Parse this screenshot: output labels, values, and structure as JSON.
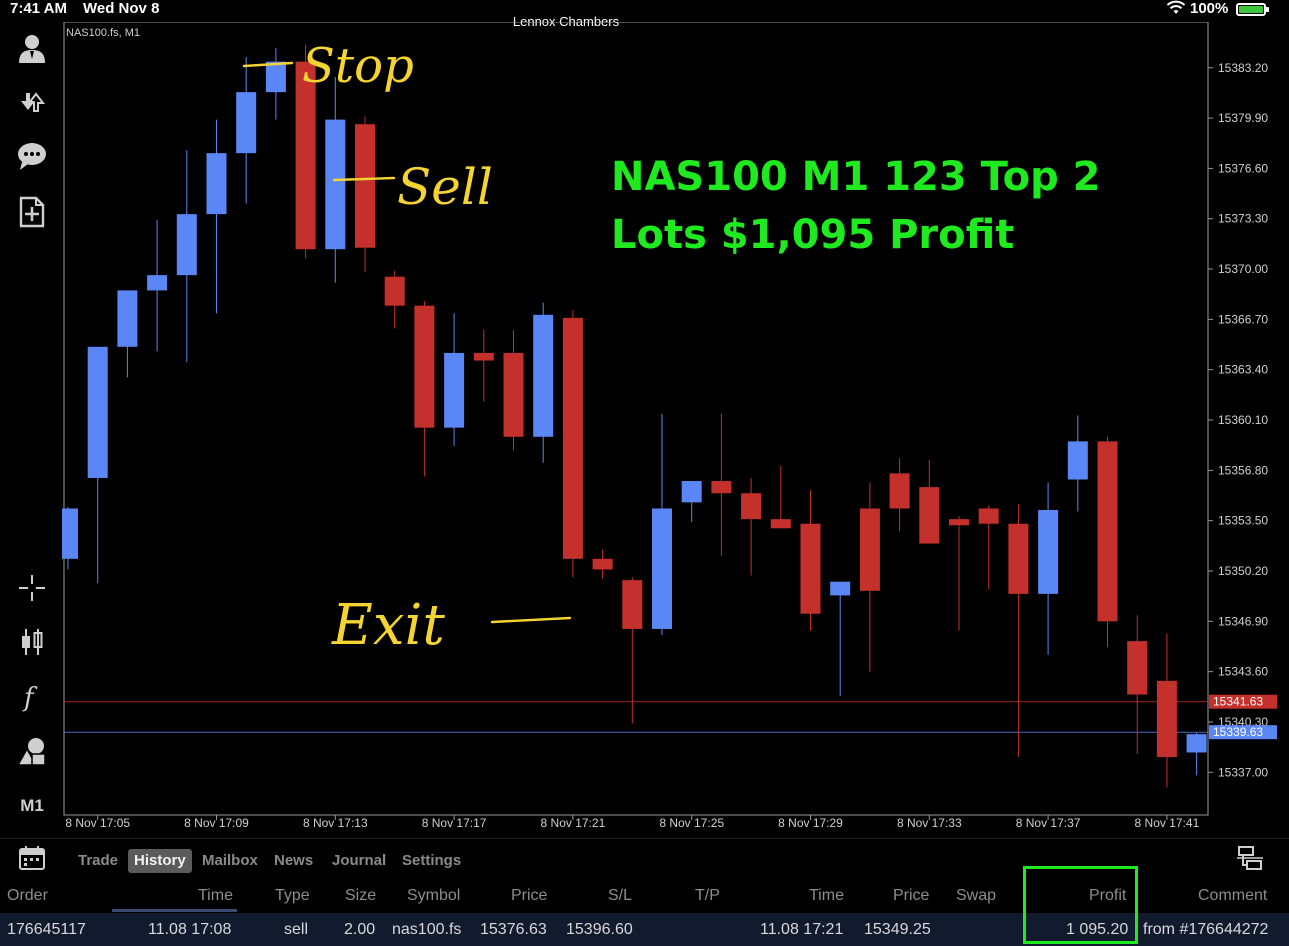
{
  "status_bar": {
    "time": "7:41 AM",
    "date": "Wed Nov 8",
    "account_name": "Lennox Chambers",
    "battery": "100%"
  },
  "toolbar": {
    "items": [
      "account-icon",
      "deposit-withdraw-icon",
      "chat-icon",
      "new-document-icon",
      "crosshair-icon",
      "candlestick-icon",
      "indicator-function-icon",
      "objects-icon"
    ],
    "timeframe": "M1"
  },
  "chart": {
    "symbol_label": "NAS100.fs, M1",
    "overlay_line1": "NAS100 M1 123 Top 2",
    "overlay_line2": "Lots $1,095 Profit",
    "annotations": [
      "Stop",
      "Sell",
      "Exit"
    ],
    "price_ticks": [
      "15383.20",
      "15379.90",
      "15376.60",
      "15373.30",
      "15370.00",
      "15366.70",
      "15363.40",
      "15360.10",
      "15356.80",
      "15353.50",
      "15350.20",
      "15346.90",
      "15343.60",
      "15340.30",
      "15337.00"
    ],
    "time_ticks": [
      "8 Nov 17:05",
      "8 Nov 17:09",
      "8 Nov 17:13",
      "8 Nov 17:17",
      "8 Nov 17:21",
      "8 Nov 17:25",
      "8 Nov 17:29",
      "8 Nov 17:33",
      "8 Nov 17:37",
      "8 Nov 17:41"
    ],
    "bid_label": "15341.63",
    "ask_label": "15339.63",
    "colors": {
      "bull": "#5b86f5",
      "bear": "#c4302b",
      "overlay": "#1fe91f",
      "annotation": "#f5d431"
    }
  },
  "chart_data": {
    "type": "candlestick",
    "ylim": [
      15334.2,
      15386.2
    ],
    "bid": 15341.63,
    "ask": 15339.63,
    "candles": [
      {
        "o": 15351.0,
        "h": 15354.4,
        "l": 15350.3,
        "c": 15354.3
      },
      {
        "o": 15356.3,
        "h": 15363.8,
        "l": 15349.4,
        "c": 15364.9
      },
      {
        "o": 15364.9,
        "h": 15367.3,
        "l": 15362.9,
        "c": 15368.6
      },
      {
        "o": 15368.6,
        "h": 15373.2,
        "l": 15364.6,
        "c": 15369.6
      },
      {
        "o": 15369.6,
        "h": 15377.8,
        "l": 15363.9,
        "c": 15373.6
      },
      {
        "o": 15373.6,
        "h": 15379.8,
        "l": 15367.1,
        "c": 15377.6
      },
      {
        "o": 15377.6,
        "h": 15383.9,
        "l": 15374.3,
        "c": 15381.6
      },
      {
        "o": 15381.6,
        "h": 15384.5,
        "l": 15379.8,
        "c": 15383.6
      },
      {
        "o": 15383.6,
        "h": 15384.7,
        "l": 15370.7,
        "c": 15371.3
      },
      {
        "o": 15371.3,
        "h": 15382.6,
        "l": 15369.1,
        "c": 15379.8
      },
      {
        "o": 15379.5,
        "h": 15380.0,
        "l": 15369.8,
        "c": 15371.4
      },
      {
        "o": 15369.5,
        "h": 15369.9,
        "l": 15366.1,
        "c": 15367.6
      },
      {
        "o": 15367.6,
        "h": 15367.9,
        "l": 15356.4,
        "c": 15359.6
      },
      {
        "o": 15359.6,
        "h": 15367.1,
        "l": 15358.4,
        "c": 15364.5
      },
      {
        "o": 15364.5,
        "h": 15366.0,
        "l": 15361.3,
        "c": 15364.0
      },
      {
        "o": 15364.5,
        "h": 15366.0,
        "l": 15358.1,
        "c": 15359.0
      },
      {
        "o": 15359.0,
        "h": 15367.8,
        "l": 15357.3,
        "c": 15367.0
      },
      {
        "o": 15366.8,
        "h": 15367.3,
        "l": 15349.8,
        "c": 15351.0
      },
      {
        "o": 15351.0,
        "h": 15351.6,
        "l": 15349.7,
        "c": 15350.3
      },
      {
        "o": 15349.6,
        "h": 15349.8,
        "l": 15340.2,
        "c": 15346.4
      },
      {
        "o": 15346.4,
        "h": 15360.5,
        "l": 15346.0,
        "c": 15354.3
      },
      {
        "o": 15354.7,
        "h": 15356.0,
        "l": 15353.4,
        "c": 15356.1
      },
      {
        "o": 15356.1,
        "h": 15360.5,
        "l": 15351.2,
        "c": 15355.3
      },
      {
        "o": 15355.3,
        "h": 15356.3,
        "l": 15349.9,
        "c": 15353.6
      },
      {
        "o": 15353.6,
        "h": 15357.1,
        "l": 15353.2,
        "c": 15353.0
      },
      {
        "o": 15353.3,
        "h": 15355.5,
        "l": 15346.3,
        "c": 15347.4
      },
      {
        "o": 15348.6,
        "h": 15348.8,
        "l": 15342.0,
        "c": 15349.5
      },
      {
        "o": 15354.3,
        "h": 15356.0,
        "l": 15343.6,
        "c": 15348.9
      },
      {
        "o": 15356.6,
        "h": 15357.6,
        "l": 15352.8,
        "c": 15354.3
      },
      {
        "o": 15355.7,
        "h": 15357.5,
        "l": 15352.4,
        "c": 15352.0
      },
      {
        "o": 15353.6,
        "h": 15353.8,
        "l": 15346.3,
        "c": 15353.2
      },
      {
        "o": 15354.3,
        "h": 15354.5,
        "l": 15349.0,
        "c": 15353.3
      },
      {
        "o": 15353.3,
        "h": 15354.6,
        "l": 15338.0,
        "c": 15348.7
      },
      {
        "o": 15348.7,
        "h": 15356.0,
        "l": 15344.7,
        "c": 15354.2
      },
      {
        "o": 15356.2,
        "h": 15360.4,
        "l": 15354.1,
        "c": 15358.7
      },
      {
        "o": 15358.7,
        "h": 15359.0,
        "l": 15345.2,
        "c": 15346.9
      },
      {
        "o": 15345.6,
        "h": 15347.3,
        "l": 15338.2,
        "c": 15342.1
      },
      {
        "o": 15343.0,
        "h": 15346.1,
        "l": 15336.0,
        "c": 15338.0
      },
      {
        "o": 15338.3,
        "h": 15339.6,
        "l": 15336.8,
        "c": 15339.5
      }
    ]
  },
  "tabs": {
    "items": [
      "Trade",
      "History",
      "Mailbox",
      "News",
      "Journal",
      "Settings"
    ],
    "active": "History"
  },
  "history": {
    "columns": [
      "Order",
      "Time",
      "Type",
      "Size",
      "Symbol",
      "Price",
      "S/L",
      "T/P",
      "Time",
      "Price",
      "Swap",
      "Profit",
      "Comment"
    ],
    "rows": [
      {
        "order": "176645117",
        "open_time": "11.08 17:08",
        "type": "sell",
        "size": "2.00",
        "symbol": "nas100.fs",
        "price": "15376.63",
        "sl": "15396.60",
        "tp": "",
        "close_time": "11.08 17:21",
        "close_price": "15349.25",
        "swap": "",
        "profit": "1 095.20",
        "comment": "from #176644272"
      }
    ]
  }
}
